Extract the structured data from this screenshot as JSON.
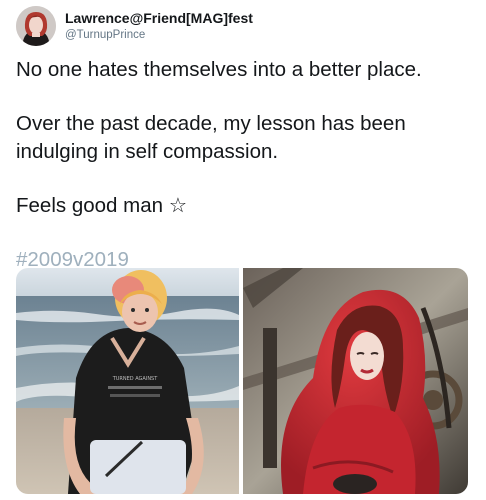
{
  "author": {
    "display_name": "Lawrence@Friend[MAG]fest",
    "handle": "@TurnupPrince",
    "avatar_icon": "profile-photo"
  },
  "tweet": {
    "line1": "No one hates themselves into a better place.",
    "line2": "Over the past decade, my lesson has been",
    "line3": "indulging in self compassion.",
    "line4": "Feels good man ☆",
    "hashtag": "#2009v2019"
  },
  "media": {
    "photo_left_text": "TURNED AGAINST",
    "photo_count": 2
  },
  "colors": {
    "text": "#14171a",
    "secondary": "#657786",
    "hashtag": "#9fb0bd"
  }
}
